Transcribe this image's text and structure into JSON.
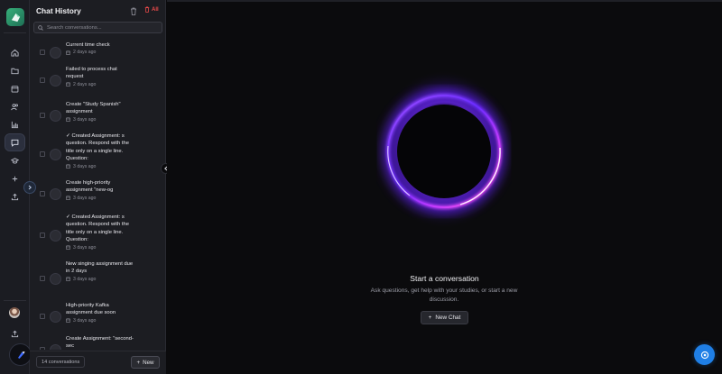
{
  "sidebar_nav": {
    "items": [
      {
        "icon": "home-icon"
      },
      {
        "icon": "folder-icon"
      },
      {
        "icon": "calendar-icon"
      },
      {
        "icon": "users-icon"
      },
      {
        "icon": "chart-icon"
      },
      {
        "icon": "chat-icon",
        "active": true
      },
      {
        "icon": "graduation-cap-icon"
      },
      {
        "icon": "plus-icon"
      },
      {
        "icon": "upload-icon"
      }
    ]
  },
  "chat_history": {
    "title": "Chat History",
    "delete_all_label": "All",
    "search_placeholder": "Search conversations...",
    "conversations": [
      {
        "title": "Current time check",
        "date": "2 days ago"
      },
      {
        "title": "Failed to process chat request",
        "date": "2 days ago"
      },
      {
        "title": "Create \"Study Spanish\" assignment",
        "date": "3 days ago"
      },
      {
        "title": "✓ Created Assignment: s question. Respond with the title only on a single line. Question:",
        "date": "3 days ago"
      },
      {
        "title": "Create high-priority assignment \"new-og",
        "date": "3 days ago"
      },
      {
        "title": "✓ Created Assignment: s question. Respond with the title only on a single line. Question:",
        "date": "3 days ago"
      },
      {
        "title": "New singing assignment due in 2 days",
        "date": "3 days ago"
      },
      {
        "title": "High-priority Kafka assignment due soon",
        "date": "3 days ago"
      },
      {
        "title": "Create Assignment: \"second-sec",
        "date": "3 days ago"
      }
    ],
    "count_label": "14 conversations",
    "new_label": "New"
  },
  "main": {
    "title": "Start a conversation",
    "subtitle": "Ask questions, get help with your studies, or start a new discussion.",
    "new_chat_label": "New Chat"
  },
  "colors": {
    "accent_blue": "#1f7fe6",
    "ring_purple": "#8b3dff",
    "ring_pink": "#ff4fd8",
    "danger": "#ef4b4b"
  }
}
